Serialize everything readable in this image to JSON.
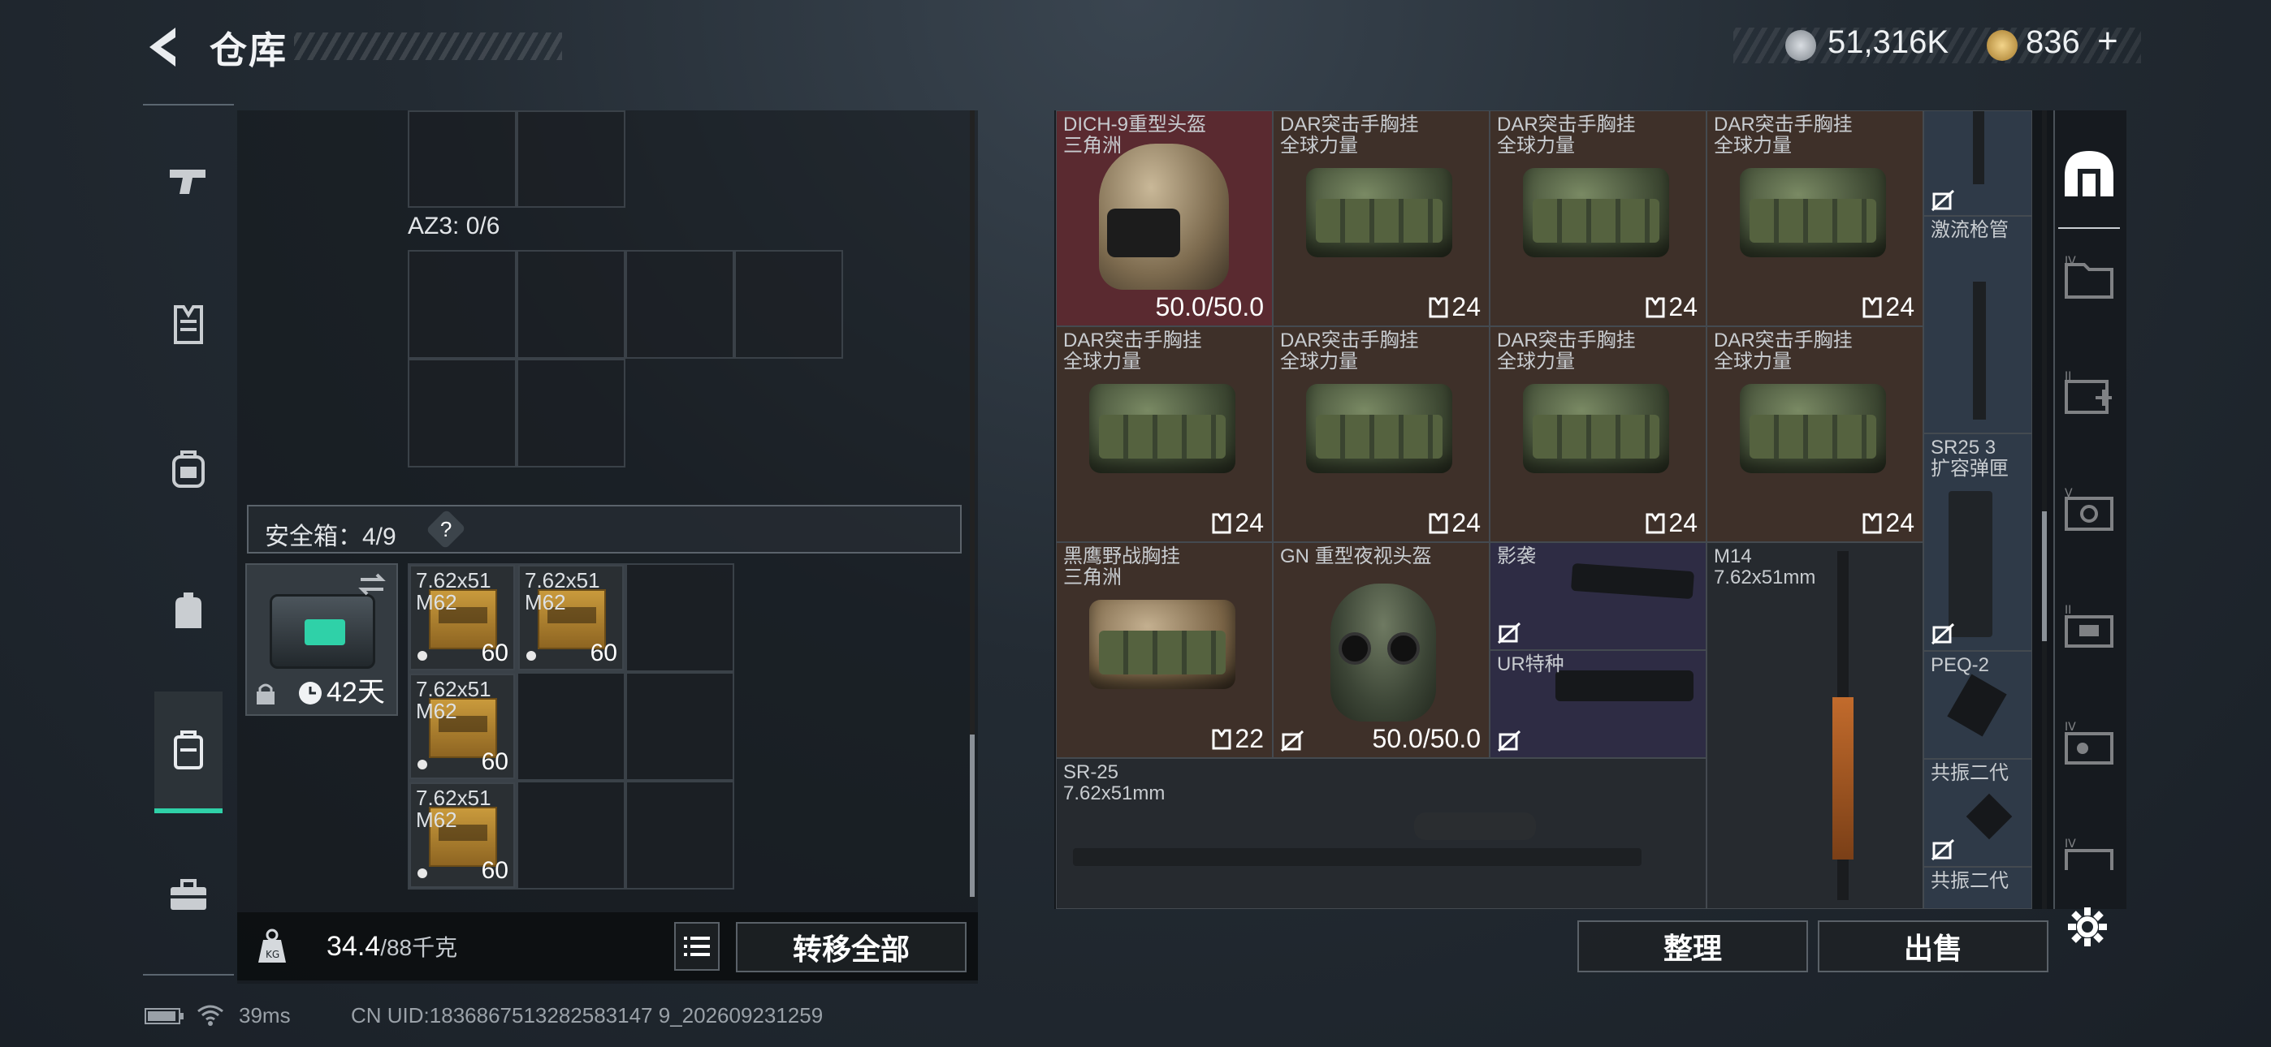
{
  "header": {
    "title": "仓库",
    "currency1": "51,316K",
    "currency2": "836",
    "add_label": "+"
  },
  "nav": {
    "items": [
      "weapon-icon",
      "vest-icon",
      "backpack-icon",
      "pouch-icon",
      "safebox-icon",
      "toolbox-icon"
    ],
    "active": "safebox-icon"
  },
  "left": {
    "az3_label": "AZ3: 0/6",
    "safe_label": "安全箱：4/9",
    "safe_help": "?",
    "safebox_days": "42天",
    "ammo_items": [
      {
        "name": "7.62x51\nM62",
        "count": "60"
      },
      {
        "name": "7.62x51\nM62",
        "count": "60"
      },
      {
        "name": "7.62x51\nM62",
        "count": "60"
      },
      {
        "name": "7.62x51\nM62",
        "count": "60"
      }
    ],
    "weight_value": "34.4",
    "weight_max": "/88千克",
    "transfer_all": "转移全部"
  },
  "right": {
    "tiles": [
      {
        "name": "DICH-9重型头盔\n三角洲",
        "value": "50.0/50.0"
      },
      {
        "name": "DAR突击手胸挂\n全球力量",
        "value": "24"
      },
      {
        "name": "DAR突击手胸挂\n全球力量",
        "value": "24"
      },
      {
        "name": "DAR突击手胸挂\n全球力量",
        "value": "24"
      },
      {
        "name": "激流枪管",
        "value": ""
      },
      {
        "name": "DAR突击手胸挂\n全球力量",
        "value": "24"
      },
      {
        "name": "DAR突击手胸挂\n全球力量",
        "value": "24"
      },
      {
        "name": "DAR突击手胸挂\n全球力量",
        "value": "24"
      },
      {
        "name": "DAR突击手胸挂\n全球力量",
        "value": "24"
      },
      {
        "name": "SR25 3\n扩容弹匣",
        "value": ""
      },
      {
        "name": "黑鹰野战胸挂\n三角洲",
        "value": "22"
      },
      {
        "name": "GN 重型夜视头盔",
        "value": "50.0/50.0"
      },
      {
        "name": "影袭",
        "value": ""
      },
      {
        "name": "UR特种",
        "value": ""
      },
      {
        "name": "M14\n7.62x51mm",
        "value": ""
      },
      {
        "name": "PEQ-2",
        "value": ""
      },
      {
        "name": "共振二代",
        "value": ""
      },
      {
        "name": "共振二代",
        "value": ""
      },
      {
        "name": "SR-25\n7.62x51mm",
        "value": ""
      }
    ],
    "sort_label": "整理",
    "sell_label": "出售"
  },
  "status": {
    "ping": "39ms",
    "uid": "CN UID:1836867513282583147 9_202609231259"
  },
  "colors": {
    "accent": "#2fd1a8"
  }
}
